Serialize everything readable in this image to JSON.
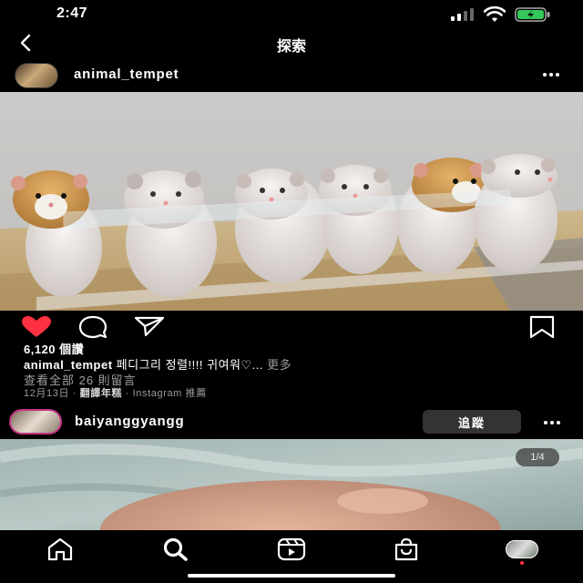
{
  "status_bar": {
    "time": "2:47"
  },
  "nav": {
    "title": "探索"
  },
  "post1": {
    "username": "animal_tempet",
    "likes": "6,120 個讚",
    "caption_user": "animal_tempet",
    "caption_text": "페디그리 정렬!!!! 귀여워♡...",
    "caption_more": "更多",
    "view_comments": "查看全部 26 則留言",
    "date": "12月13日",
    "translate": "翻譯年糕",
    "source": "Instagram 推薦"
  },
  "post2": {
    "username": "baiyanggyangg",
    "follow_label": "追蹤",
    "page_indicator": "1/4"
  },
  "icons": {
    "heart": "heart-icon",
    "comment": "comment-icon",
    "share": "share-icon",
    "bookmark": "bookmark-icon",
    "home": "home-icon",
    "search": "search-icon",
    "reels": "reels-icon",
    "shop": "shop-icon"
  },
  "colors": {
    "like_red": "#ff3040",
    "background": "#000000",
    "follow_button": "#333333"
  }
}
